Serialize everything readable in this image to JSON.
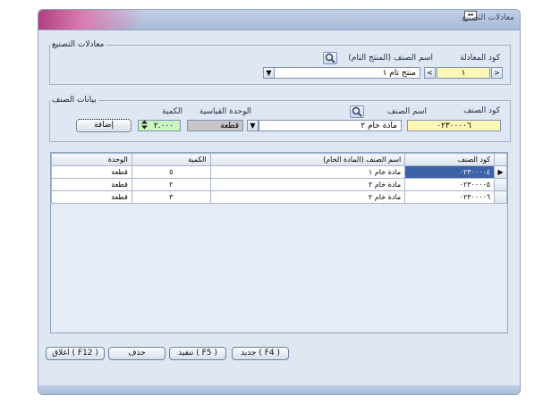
{
  "window": {
    "title": "معادلات التصنيع",
    "title_icon": "↔"
  },
  "equation_group": {
    "legend": "معادلات التصنيع",
    "code_label": "كود المعادلة",
    "code_value": "١",
    "product_label": "اسم الصنف (المنتج التام)",
    "product_value": "منتج تام ١",
    "prev_glyph": "<",
    "next_glyph": ">",
    "dropdown_glyph": "▼"
  },
  "item_group": {
    "legend": "بيانات الصنف",
    "item_code_label": "كود الصنف",
    "item_code_value": "٠٢٣٠٠٠٠٦",
    "item_name_label": "اسم الصنف",
    "item_name_value": "مادة خام ٢",
    "unit_label": "الوحدة القياسية",
    "unit_value": "قطعة",
    "qty_label": "الكمية",
    "qty_value": "٢.٠٠٠",
    "add_button": "إضافة",
    "dropdown_glyph": "▼"
  },
  "grid": {
    "columns": [
      "كود الصنف",
      "اسم الصنف (المادة الخام)",
      "الكمية",
      "الوحدة"
    ],
    "rows": [
      {
        "code": "٠٢٣٠٠٠٠٤",
        "name": "مادة خام ١",
        "qty": "٥",
        "unit": "قطعة",
        "current": "▶"
      },
      {
        "code": "٠٢٣٠٠٠٠٥",
        "name": "مادة خام ٢",
        "qty": "٢",
        "unit": "قطعة",
        "current": ""
      },
      {
        "code": "٠٢٣٠٠٠٠٦",
        "name": "مادة خام ٢",
        "qty": "٣",
        "unit": "قطعة",
        "current": ""
      }
    ]
  },
  "buttons": {
    "new": "جديد ( F4 )",
    "save": "تنفيذ ( F5 )",
    "delete": "حذف",
    "close": "اغلاق ( F12 )"
  }
}
